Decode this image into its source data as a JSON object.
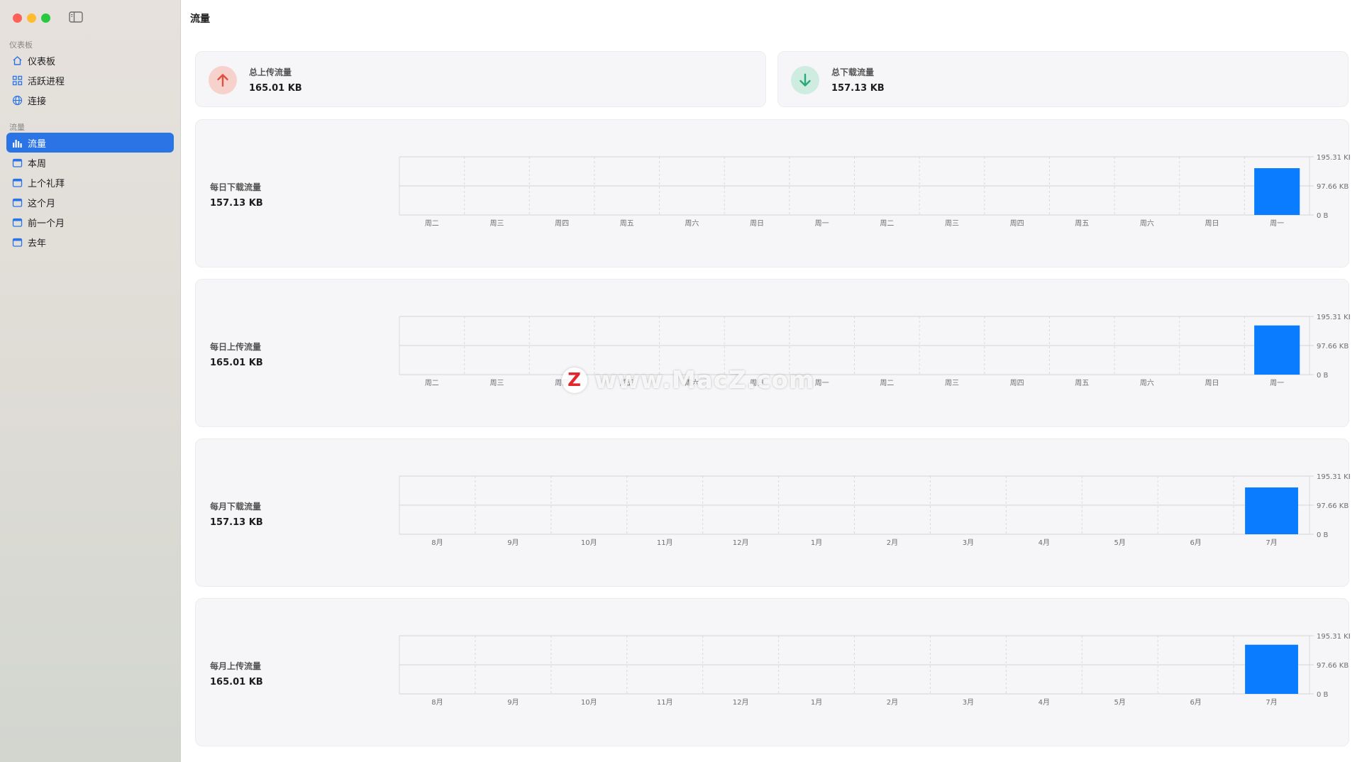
{
  "window": {
    "title": "流量"
  },
  "sidebar": {
    "section1": "仪表板",
    "items1": [
      {
        "label": "仪表板",
        "icon": "house-icon"
      },
      {
        "label": "活跃进程",
        "icon": "grid-icon"
      },
      {
        "label": "连接",
        "icon": "globe-icon"
      }
    ],
    "section2": "流量",
    "items2": [
      {
        "label": "流量",
        "icon": "bar-chart-icon",
        "active": true
      },
      {
        "label": "本周",
        "icon": "calendar-icon"
      },
      {
        "label": "上个礼拜",
        "icon": "calendar-icon"
      },
      {
        "label": "这个月",
        "icon": "calendar-icon"
      },
      {
        "label": "前一个月",
        "icon": "calendar-icon"
      },
      {
        "label": "去年",
        "icon": "calendar-icon"
      }
    ]
  },
  "summary": {
    "upload": {
      "label": "总上传流量",
      "value": "165.01 KB",
      "color": "#e0513f",
      "bg": "#f7d2cd"
    },
    "download": {
      "label": "总下载流量",
      "value": "157.13 KB",
      "color": "#2aa876",
      "bg": "#cfece1"
    }
  },
  "cards": [
    {
      "label": "每日下载流量",
      "value": "157.13 KB"
    },
    {
      "label": "每日上传流量",
      "value": "165.01 KB"
    },
    {
      "label": "每月下载流量",
      "value": "157.13 KB"
    },
    {
      "label": "每月上传流量",
      "value": "165.01 KB"
    }
  ],
  "watermark": {
    "logo": "Z",
    "text": "www.MacZ.com"
  },
  "chart_data": [
    {
      "type": "bar",
      "categories": [
        "周二",
        "周三",
        "周四",
        "周五",
        "周六",
        "周日",
        "周一",
        "周二",
        "周三",
        "周四",
        "周五",
        "周六",
        "周日",
        "周一"
      ],
      "values": [
        0,
        0,
        0,
        0,
        0,
        0,
        0,
        0,
        0,
        0,
        0,
        0,
        0,
        157.13
      ],
      "yticks": [
        "195.31 KB",
        "97.66 KB",
        "0 B"
      ],
      "ylim": [
        0,
        195.31
      ],
      "color": "#0a7cff"
    },
    {
      "type": "bar",
      "categories": [
        "周二",
        "周三",
        "周四",
        "周五",
        "周六",
        "周日",
        "周一",
        "周二",
        "周三",
        "周四",
        "周五",
        "周六",
        "周日",
        "周一"
      ],
      "values": [
        0,
        0,
        0,
        0,
        0,
        0,
        0,
        0,
        0,
        0,
        0,
        0,
        0,
        165.01
      ],
      "yticks": [
        "195.31 KB",
        "97.66 KB",
        "0 B"
      ],
      "ylim": [
        0,
        195.31
      ],
      "color": "#0a7cff"
    },
    {
      "type": "bar",
      "categories": [
        "8月",
        "9月",
        "10月",
        "11月",
        "12月",
        "1月",
        "2月",
        "3月",
        "4月",
        "5月",
        "6月",
        "7月"
      ],
      "values": [
        0,
        0,
        0,
        0,
        0,
        0,
        0,
        0,
        0,
        0,
        0,
        157.13
      ],
      "yticks": [
        "195.31 KB",
        "97.66 KB",
        "0 B"
      ],
      "ylim": [
        0,
        195.31
      ],
      "color": "#0a7cff"
    },
    {
      "type": "bar",
      "categories": [
        "8月",
        "9月",
        "10月",
        "11月",
        "12月",
        "1月",
        "2月",
        "3月",
        "4月",
        "5月",
        "6月",
        "7月"
      ],
      "values": [
        0,
        0,
        0,
        0,
        0,
        0,
        0,
        0,
        0,
        0,
        0,
        165.01
      ],
      "yticks": [
        "195.31 KB",
        "97.66 KB",
        "0 B"
      ],
      "ylim": [
        0,
        195.31
      ],
      "color": "#0a7cff"
    }
  ]
}
